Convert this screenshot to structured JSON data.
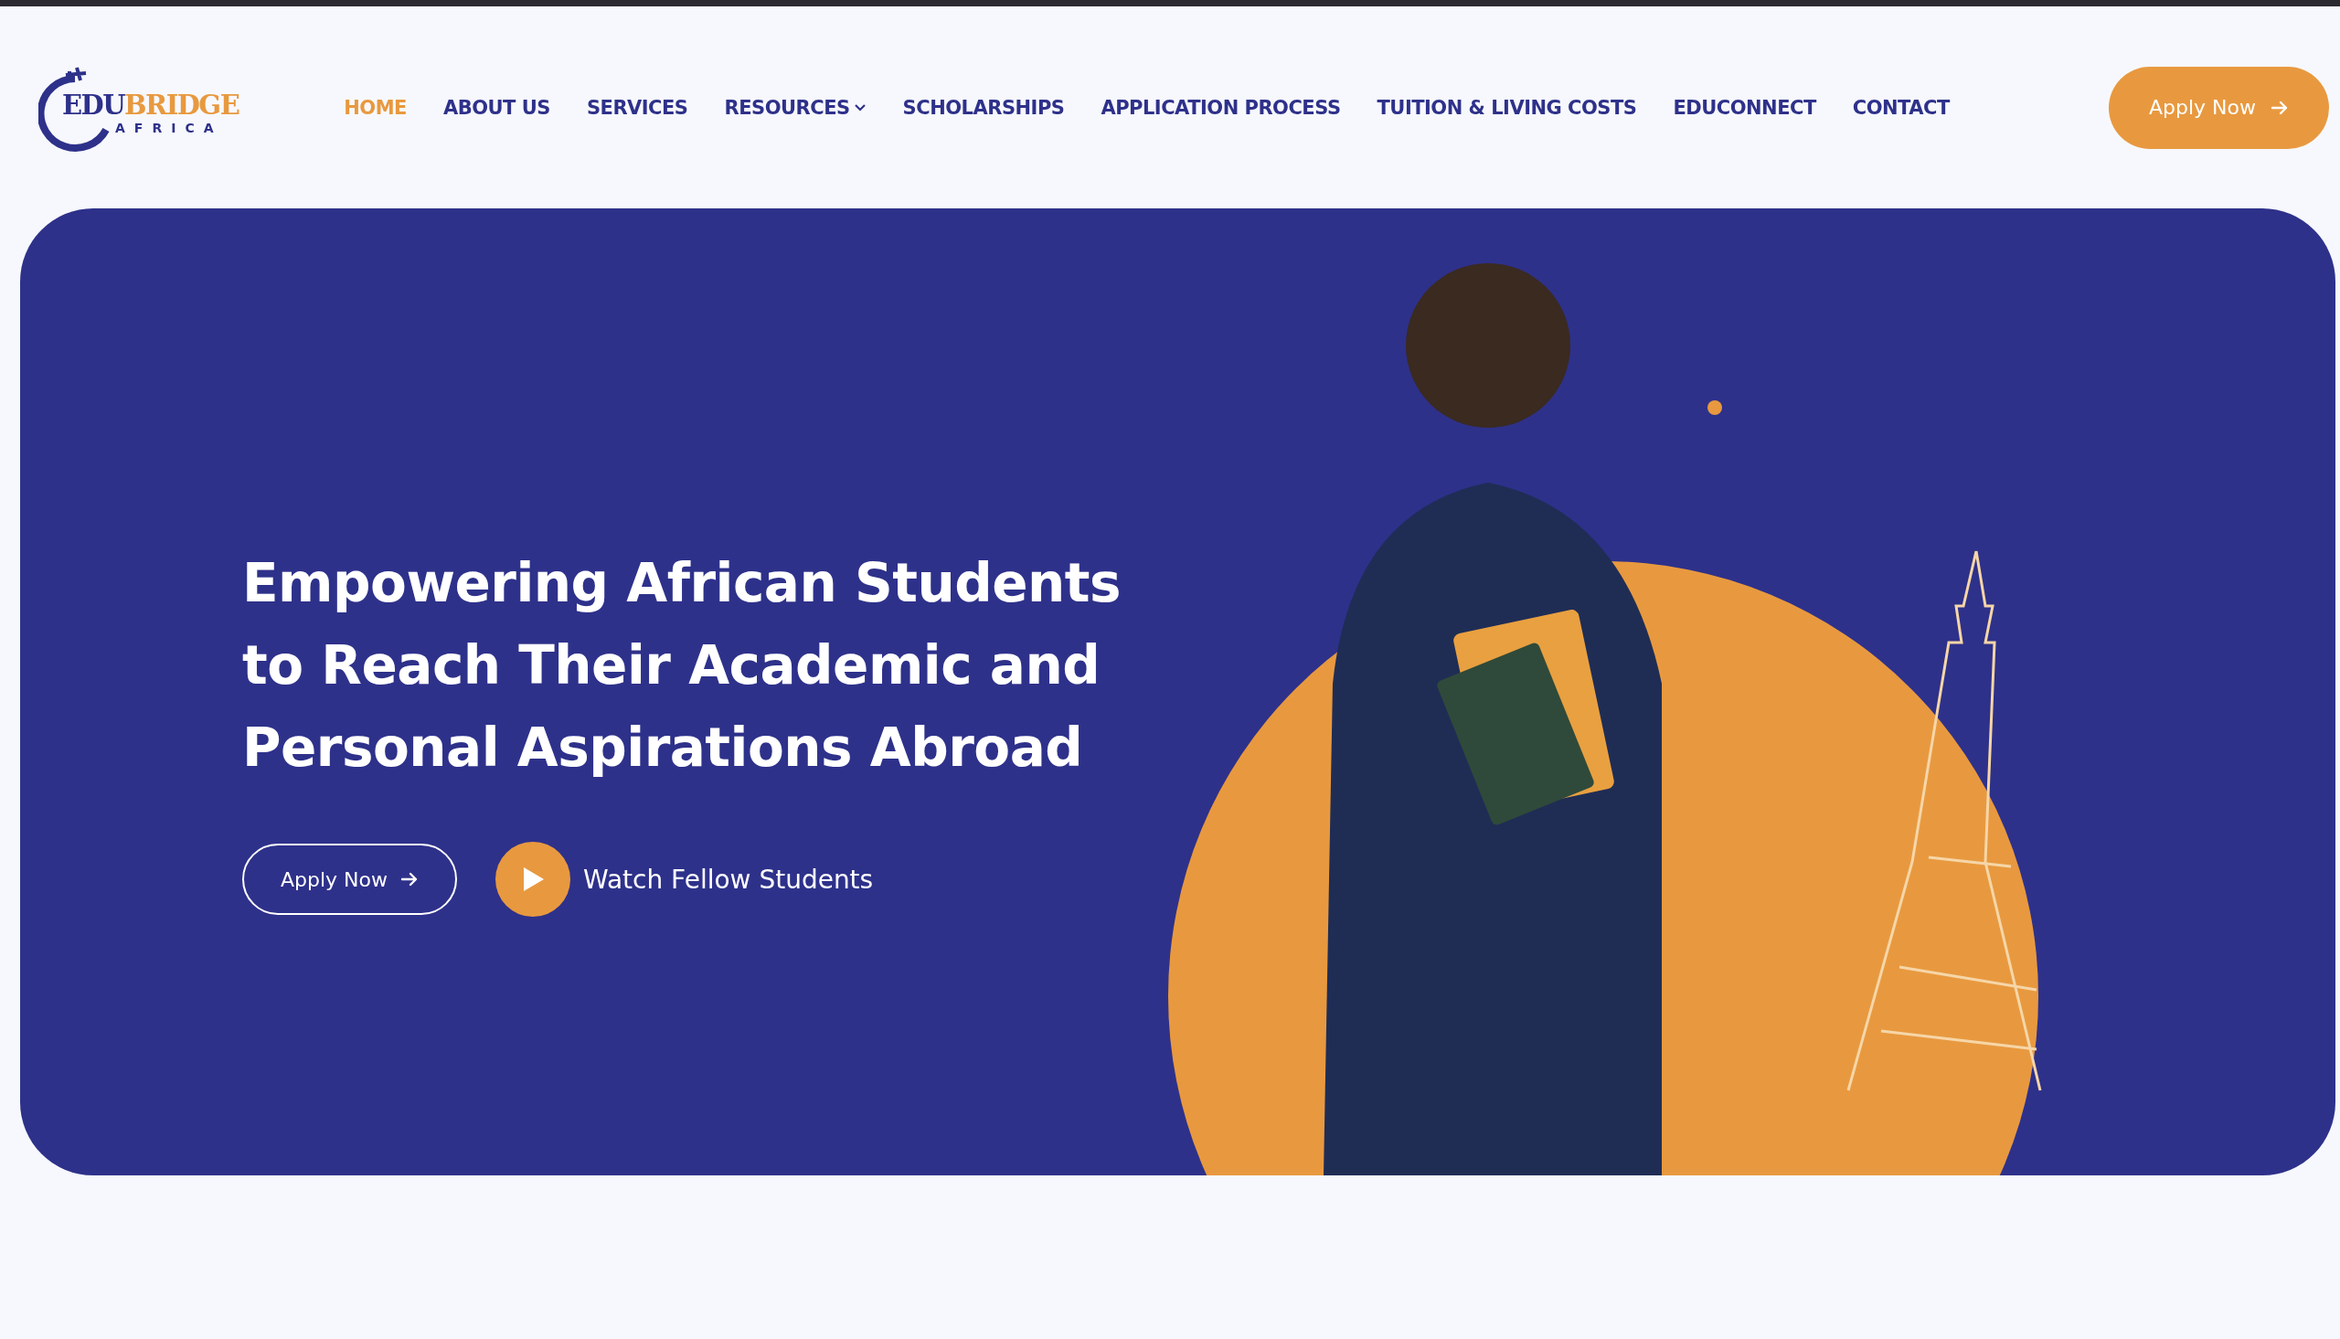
{
  "logo": {
    "brand_part_1": "EDU",
    "brand_part_2": "BRIDGE",
    "tagline": "AFRICA"
  },
  "nav": [
    {
      "label": "HOME",
      "selected": true,
      "dropdown": false
    },
    {
      "label": "ABOUT US",
      "selected": false,
      "dropdown": false
    },
    {
      "label": "SERVICES",
      "selected": false,
      "dropdown": false
    },
    {
      "label": "RESOURCES",
      "selected": false,
      "dropdown": true
    },
    {
      "label": "SCHOLARSHIPS",
      "selected": false,
      "dropdown": false
    },
    {
      "label": "APPLICATION PROCESS",
      "selected": false,
      "dropdown": false
    },
    {
      "label": "TUITION & LIVING COSTS",
      "selected": false,
      "dropdown": false
    },
    {
      "label": "EDUCONNECT",
      "selected": false,
      "dropdown": false
    },
    {
      "label": "CONTACT",
      "selected": false,
      "dropdown": false
    }
  ],
  "header_button": "Apply Now",
  "hero": {
    "headline": [
      "Empowering African Students",
      "to Reach Their Academic and",
      "Personal Aspirations Abroad"
    ],
    "apply_button": "Apply Now",
    "video_link": "Watch Fellow Students"
  }
}
